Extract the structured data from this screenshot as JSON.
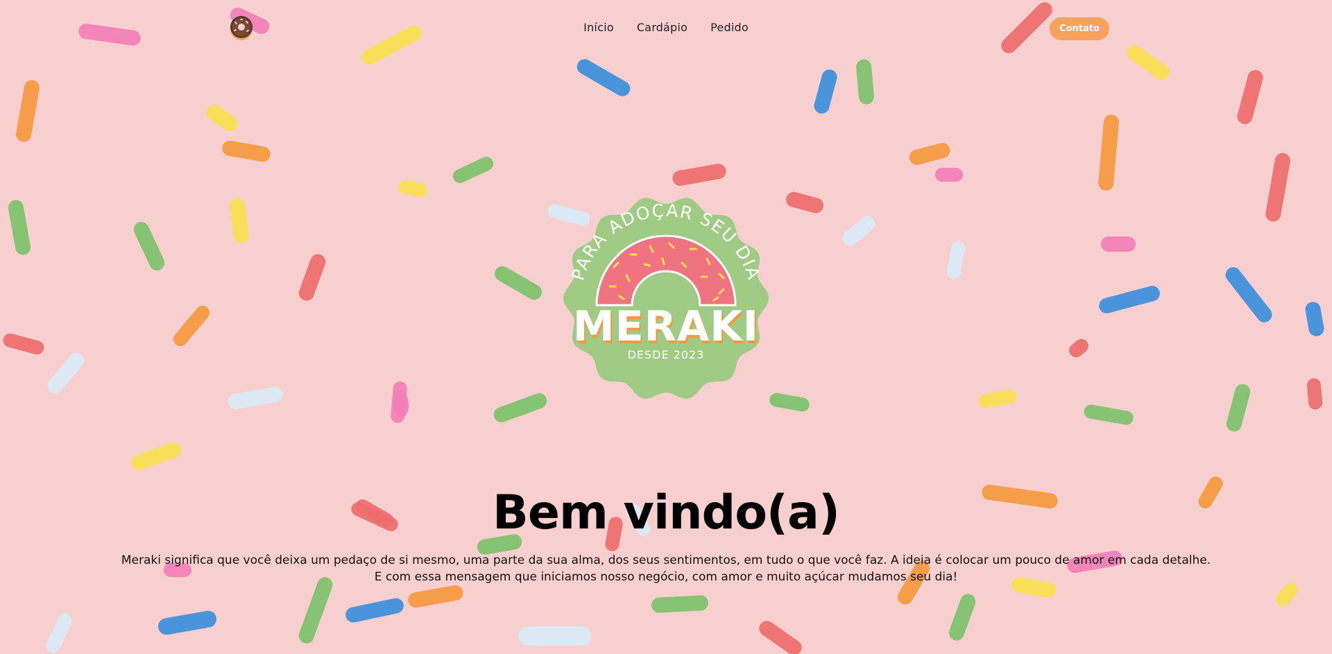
{
  "colors": {
    "background": "#f8cfcf",
    "accent": "#f7a35c",
    "badge_green": "#9fcb84",
    "donut_pink": "#ef7381",
    "sprinkles": [
      "#ee6e6e",
      "#f5993f",
      "#f7e04f",
      "#7cc26b",
      "#3a8fdc",
      "#f27fba",
      "#d9ecf9"
    ]
  },
  "header": {
    "logo_icon": "donut-icon",
    "nav": [
      {
        "label": "Início"
      },
      {
        "label": "Cardápio"
      },
      {
        "label": "Pedido"
      }
    ],
    "contact_label": "Contato"
  },
  "badge": {
    "arc_text": "PARA ADOÇAR SEU DIA",
    "brand": "MERAKI",
    "since": "DESDE 2023"
  },
  "hero": {
    "title": "Bem vindo(a)",
    "line1": "Meraki significa que você deixa um pedaço de si mesmo, uma parte da sua alma, dos seus sentimentos, em tudo o que você faz. A ideia é colocar um pouco de amor em cada detalhe.",
    "line2": "E com essa mensagem que iniciamos nosso negócio, com amor e muito açúcar mudamos seu dia!"
  }
}
